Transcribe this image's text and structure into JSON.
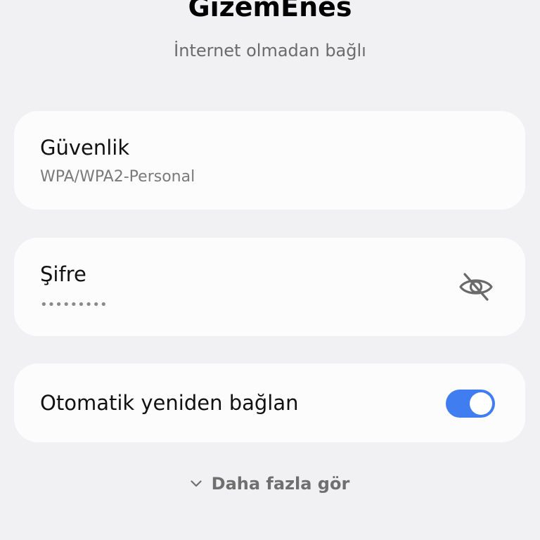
{
  "network": {
    "name": "GizemEnes",
    "status": "İnternet olmadan bağlı"
  },
  "security": {
    "title": "Güvenlik",
    "value": "WPA/WPA2-Personal"
  },
  "password": {
    "title": "Şifre",
    "masked_value": "•••••••••",
    "visibility_icon": "eye-off-icon"
  },
  "auto_reconnect": {
    "label": "Otomatik yeniden bağlan",
    "enabled": true
  },
  "see_more": {
    "label": "Daha fazla gör",
    "icon": "chevron-down-icon"
  },
  "colors": {
    "background": "#f1f1f3",
    "card": "#fcfcfd",
    "accent": "#3f7df0",
    "secondary_text": "#7a7a7a"
  }
}
